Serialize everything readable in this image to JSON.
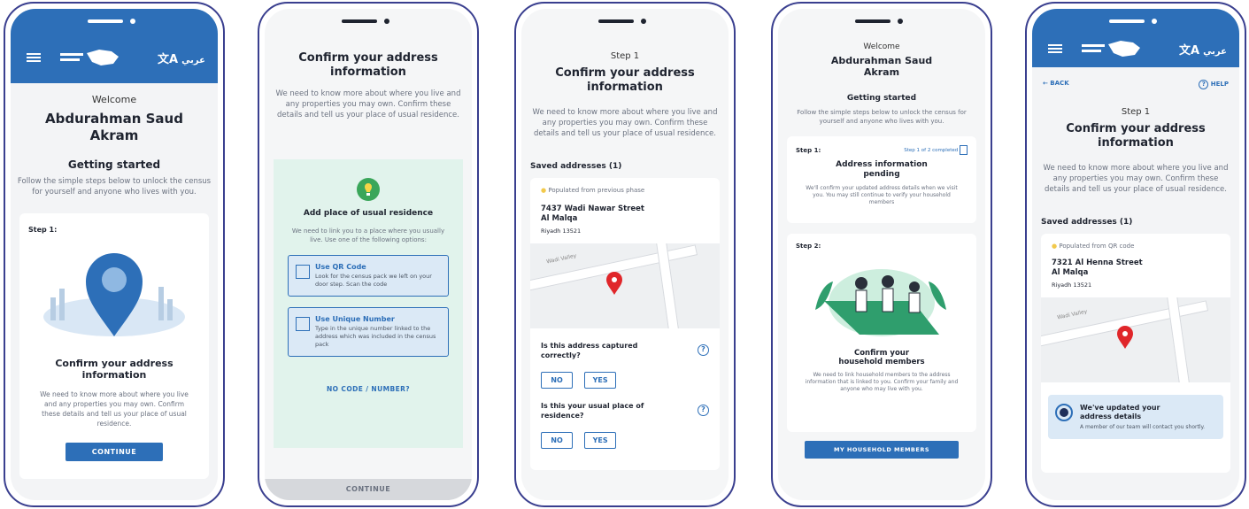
{
  "app": {
    "lang_label": "عربي",
    "lang_glyph": "文A"
  },
  "screen1": {
    "welcome": "Welcome",
    "name_line1": "Abdurahman Saud",
    "name_line2": "Akram",
    "section_title": "Getting started",
    "section_desc": "Follow the simple steps below to unlock the census for yourself and anyone who lives with you.",
    "step_label": "Step 1:",
    "card_title_line1": "Confirm your address",
    "card_title_line2": "information",
    "card_desc": "We need to know more about where you live and any properties you may own. Confirm these details and tell us your place of usual residence.",
    "continue_label": "CONTINUE"
  },
  "screen2": {
    "title_line1": "Confirm your address",
    "title_line2": "information",
    "desc": "We need to know more about where you live and any properties you may own. Confirm these details and tell us your place of usual residence.",
    "panel_title": "Add place of usual residence",
    "panel_desc": "We need to link you to a place where you usually live. Use one of the following options:",
    "options": [
      {
        "title": "Use QR Code",
        "desc": "Look for the census pack we left on your door step. Scan the code"
      },
      {
        "title": "Use Unique Number",
        "desc": "Type in the unique number linked to the address which was included in the census pack"
      }
    ],
    "no_code_label": "NO CODE / NUMBER?",
    "continue_label": "CONTINUE"
  },
  "screen3": {
    "step": "Step 1",
    "title_line1": "Confirm your address",
    "title_line2": "information",
    "desc": "We need to know more about where you live and any properties you may own. Confirm these details and tell us your place of usual residence.",
    "saved_heading": "Saved addresses (1)",
    "source": "Populated from previous phase",
    "street_line1": "7437 Wadi Nawar Street",
    "street_line2": "Al Malqa",
    "city": "Riyadh 13521",
    "map_road_label": "Wadi Valley",
    "q1_line1": "Is this address captured",
    "q1_line2": "correctly?",
    "q2_line1": "Is this your usual place of",
    "q2_line2": "residence?",
    "no_label": "NO",
    "yes_label": "YES"
  },
  "screen4": {
    "welcome": "Welcome",
    "name_line1": "Abdurahman Saud",
    "name_line2": "Akram",
    "section_title": "Getting started",
    "section_desc": "Follow the simple steps below to unlock the census for yourself and anyone who lives with you.",
    "step1_label": "Step 1:",
    "step1_badge": "Step 1 of 2 completed",
    "step1_title_line1": "Address information",
    "step1_title_line2": "pending",
    "step1_desc": "We'll confirm your updated address details when we visit you. You may still continue to verify your household members",
    "step2_label": "Step 2:",
    "step2_title_line1": "Confirm your",
    "step2_title_line2": "household members",
    "step2_desc": "We need to link household members to the address information that is linked to you. Confirm your family and anyone who may live with you.",
    "button_label": "MY HOUSEHOLD MEMBERS"
  },
  "screen5": {
    "back_label": "← BACK",
    "help_label": "HELP",
    "step": "Step 1",
    "title_line1": "Confirm your address",
    "title_line2": "information",
    "desc": "We need to know more about where you live and any properties you may own. Confirm these details and tell us your place of usual residence.",
    "saved_heading": "Saved addresses (1)",
    "source": "Populated from QR code",
    "street_line1": "7321 Al Henna Street",
    "street_line2": "Al Malqa",
    "city": "Riyadh 13521",
    "map_road_label": "Wadi Valley",
    "notice_title_line1": "We've updated your",
    "notice_title_line2": "address details",
    "notice_desc": "A member of our team will contact you shortly."
  },
  "colors": {
    "brand_blue": "#2d6fb8",
    "phone_frame": "#3a3f8f",
    "pin_red": "#e0262a",
    "panel_mint": "#e1f3ec"
  }
}
